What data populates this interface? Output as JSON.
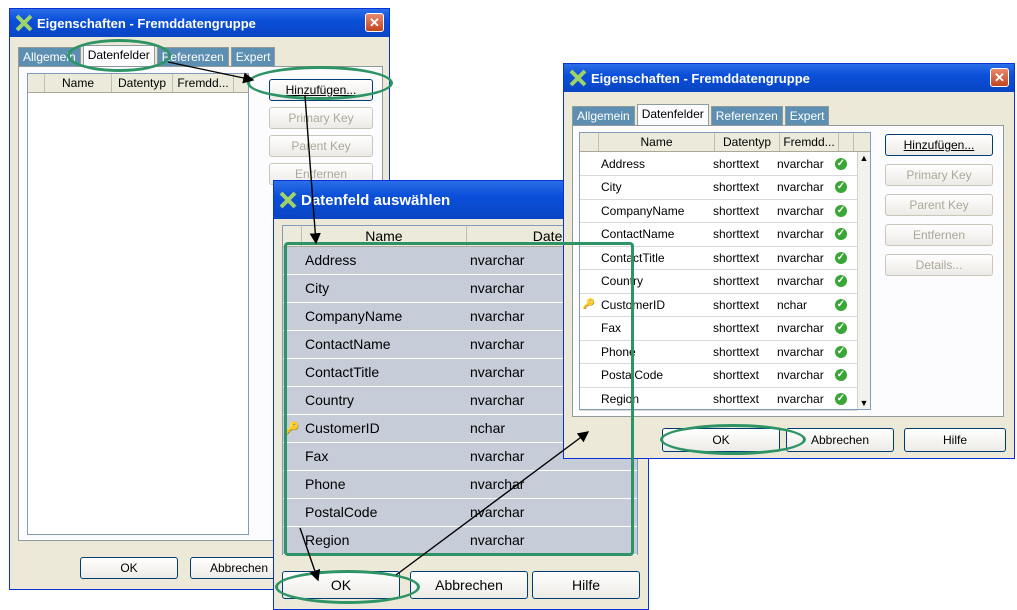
{
  "window1": {
    "title": "Eigenschaften - Fremddatengruppe",
    "tabs": [
      "Allgemein",
      "Datenfelder",
      "Referenzen",
      "Expert"
    ],
    "columns": [
      "Name",
      "Datentyp",
      "Fremdd..."
    ],
    "buttons": {
      "add": "Hinzufügen...",
      "primary": "Primary Key",
      "parent": "Parent Key",
      "remove": "Entfernen"
    },
    "ok": "OK",
    "cancel": "Abbrechen"
  },
  "window2": {
    "title": "Datenfeld auswählen",
    "columns": [
      "Name",
      "Daten"
    ],
    "rows": [
      {
        "name": "Address",
        "type": "nvarchar"
      },
      {
        "name": "City",
        "type": "nvarchar"
      },
      {
        "name": "CompanyName",
        "type": "nvarchar"
      },
      {
        "name": "ContactName",
        "type": "nvarchar"
      },
      {
        "name": "ContactTitle",
        "type": "nvarchar"
      },
      {
        "name": "Country",
        "type": "nvarchar"
      },
      {
        "name": "CustomerID",
        "type": "nchar",
        "key": true
      },
      {
        "name": "Fax",
        "type": "nvarchar"
      },
      {
        "name": "Phone",
        "type": "nvarchar"
      },
      {
        "name": "PostalCode",
        "type": "nvarchar"
      },
      {
        "name": "Region",
        "type": "nvarchar"
      }
    ],
    "ok": "OK",
    "cancel": "Abbrechen",
    "help": "Hilfe"
  },
  "window3": {
    "title": "Eigenschaften - Fremddatengruppe",
    "tabs": [
      "Allgemein",
      "Datenfelder",
      "Referenzen",
      "Expert"
    ],
    "columns": [
      "Name",
      "Datentyp",
      "Fremdd..."
    ],
    "rows": [
      {
        "name": "Address",
        "type": "shorttext",
        "foreign": "nvarchar"
      },
      {
        "name": "City",
        "type": "shorttext",
        "foreign": "nvarchar"
      },
      {
        "name": "CompanyName",
        "type": "shorttext",
        "foreign": "nvarchar"
      },
      {
        "name": "ContactName",
        "type": "shorttext",
        "foreign": "nvarchar"
      },
      {
        "name": "ContactTitle",
        "type": "shorttext",
        "foreign": "nvarchar"
      },
      {
        "name": "Country",
        "type": "shorttext",
        "foreign": "nvarchar"
      },
      {
        "name": "CustomerID",
        "type": "shorttext",
        "foreign": "nchar",
        "key": true
      },
      {
        "name": "Fax",
        "type": "shorttext",
        "foreign": "nvarchar"
      },
      {
        "name": "Phone",
        "type": "shorttext",
        "foreign": "nvarchar"
      },
      {
        "name": "PostalCode",
        "type": "shorttext",
        "foreign": "nvarchar"
      },
      {
        "name": "Region",
        "type": "shorttext",
        "foreign": "nvarchar"
      }
    ],
    "buttons": {
      "add": "Hinzufügen...",
      "primary": "Primary Key",
      "parent": "Parent Key",
      "remove": "Entfernen",
      "details": "Details..."
    },
    "ok": "OK",
    "cancel": "Abbrechen",
    "help": "Hilfe"
  },
  "colors": {
    "highlight": "#2e9466",
    "title_blue": "#0a4fd9",
    "selection": "#c6ccd8"
  }
}
